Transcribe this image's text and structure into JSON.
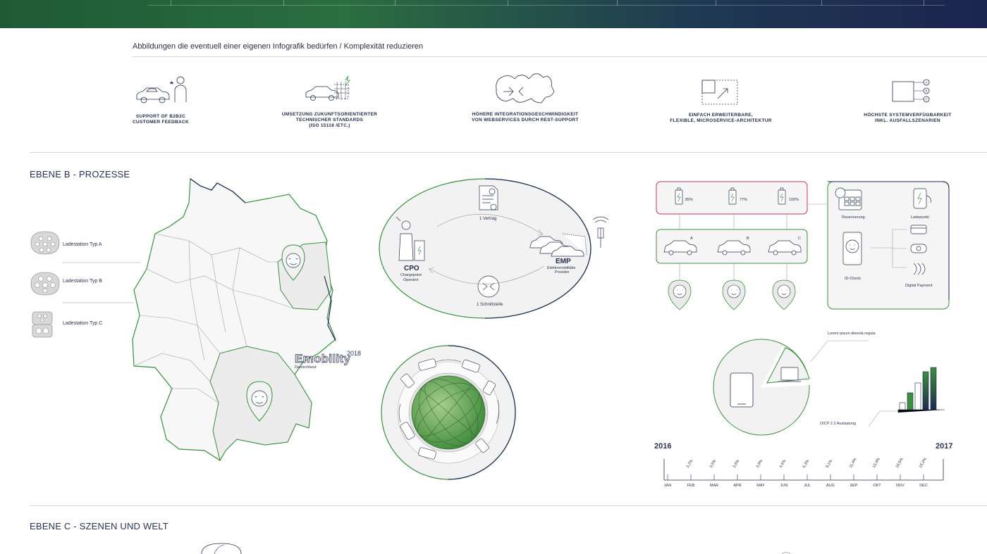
{
  "intro": "Abbildungen die eventuell einer eigenen Infografik bedürfen / Komplexität reduzieren",
  "features": [
    {
      "label": "SUPPORT OF B2B2C\nCUSTOMER FEEDBACK",
      "icon": "car-customer-icon"
    },
    {
      "label": "UMSETZUNG ZUKUNFTSORIENTIERTER\nTECHNISCHER STANDARDS\n(ISO 15118 /ETC.)",
      "icon": "car-grid-icon"
    },
    {
      "label": "HÖHERE INTEGRATIONSGESCHWINDIGKEIT\nVON WEBSERVICES DURCH REST-SUPPORT",
      "icon": "europe-exchange-icon"
    },
    {
      "label": "EINFACH ERWEITERBARE,\nFLEXIBLE, MICROSERVICE-ARCHITEKTUR",
      "icon": "expand-icon"
    },
    {
      "label": "HÖCHSTE SYSTEMVERFÜGBARKEIT\nINKL. AUSFALLSZENARIEN",
      "icon": "abc-options-icon"
    }
  ],
  "section_b": "EBENE B - PROZESSE",
  "section_c": "EBENE C - SZENEN UND WELT",
  "legend": [
    {
      "label": "Ladestation Typ A"
    },
    {
      "label": "Ladestation Typ B"
    },
    {
      "label": "Ladestation Typ C"
    }
  ],
  "map": {
    "brand": "Emobility",
    "year": "2018",
    "country": "Deutschland"
  },
  "cycle": {
    "contract": "1 Vertrag",
    "interface": "1 Schnittstelle",
    "cpo_title": "CPO",
    "cpo_sub1": "Chargepoint",
    "cpo_sub2": "Operator",
    "emp_title": "EMP",
    "emp_sub1": "Elektromobilitäts",
    "emp_sub2": "Provider"
  },
  "battery": [
    {
      "pct": "89%"
    },
    {
      "pct": "77%"
    },
    {
      "pct": "100%"
    }
  ],
  "cars": [
    {
      "label": "A"
    },
    {
      "label": "B"
    },
    {
      "label": "C"
    }
  ],
  "services": {
    "reservation": "Reservierung",
    "chargepoint": "Ladepunkt",
    "idcheck": "ID-Check",
    "payment": "Digital Payment"
  },
  "pie_note": "Lorem ipsum diesola regula",
  "bar_note": "OICP 2.2 Auslastung",
  "timeline": {
    "start": "2016",
    "end": "2017",
    "months": [
      "JAN",
      "FEB",
      "MAR",
      "APR",
      "MAY",
      "JUN",
      "JUL",
      "AUG",
      "SEP",
      "OKT",
      "NOV",
      "DEC"
    ],
    "values": [
      "",
      "3,2%",
      "3,5%",
      "3,6%",
      "3,9%",
      "4,6%",
      "6,3%",
      "9,1%",
      "11,4%",
      "13,9%",
      "18,5%",
      "19,2%"
    ]
  },
  "colors": {
    "green": "#3b8f3e",
    "navy": "#1f2a50",
    "pink": "#c8326a",
    "gray": "#f0f0f0"
  }
}
